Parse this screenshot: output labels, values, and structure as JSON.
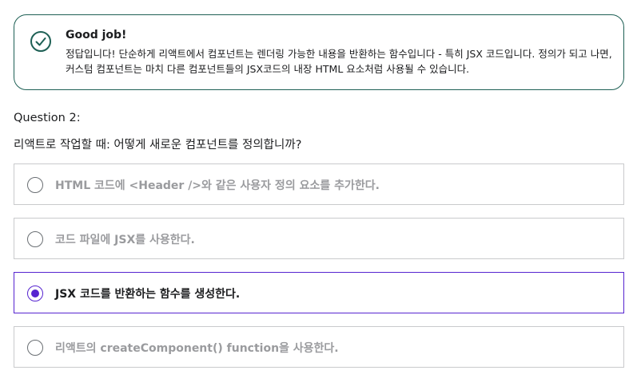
{
  "feedback": {
    "icon": "check-circle-icon",
    "title": "Good job!",
    "body": "정답입니다! 단순하게 리액트에서 컴포넌트는 렌더링 가능한 내용을 반환하는 함수입니다 - 특히 JSX 코드입니다. 정의가 되고 나면, 커스텀 컴포넌트는 마치 다른 컴포넌트들의 JSX코드의 내장 HTML 요소처럼 사용될 수 있습니다.",
    "border_color": "#1e6055"
  },
  "question": {
    "number": "Question 2:",
    "text": "리액트로 작업할 때: 어떻게 새로운 컴포넌트를 정의합니까?"
  },
  "options": [
    {
      "label": "HTML 코드에 <Header />와 같은 사용자 정의 요소를 추가한다.",
      "selected": false
    },
    {
      "label": "코드 파일에 JSX를 사용한다.",
      "selected": false
    },
    {
      "label": "JSX 코드를 반환하는 함수를 생성한다.",
      "selected": true
    },
    {
      "label": "리액트의 createComponent() function을 사용한다.",
      "selected": false
    }
  ],
  "accent_color": "#5624d0"
}
